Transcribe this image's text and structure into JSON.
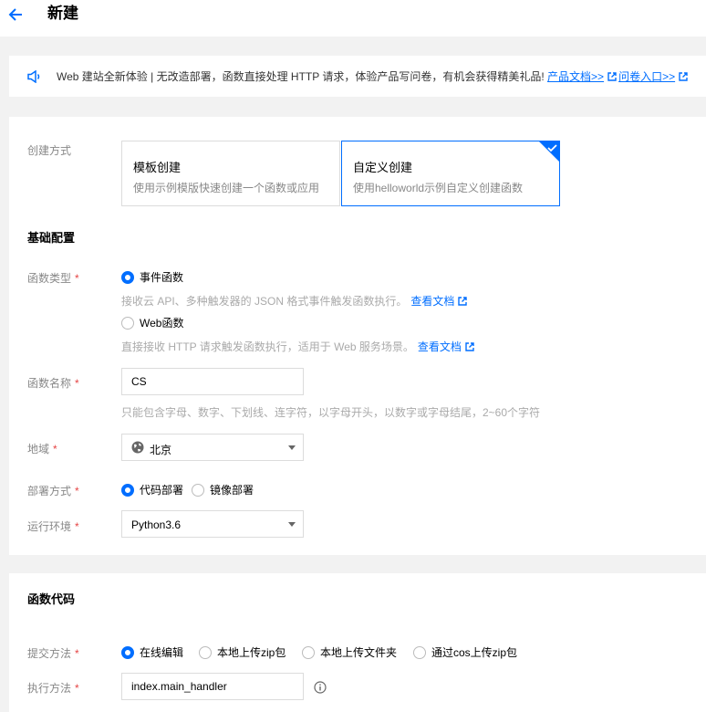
{
  "header": {
    "title": "新建"
  },
  "notice": {
    "text": "Web 建站全新体验 | 无改造部署，函数直接处理 HTTP 请求，体验产品写问卷，有机会获得精美礼品!",
    "link_docs": "产品文档>>",
    "link_survey": "问卷入口>>"
  },
  "create_method": {
    "label": "创建方式",
    "cards": [
      {
        "title": "模板创建",
        "desc": "使用示例模版快速创建一个函数或应用"
      },
      {
        "title": "自定义创建",
        "desc": "使用helloworld示例自定义创建函数"
      }
    ],
    "selected_index": 1
  },
  "basic": {
    "section_title": "基础配置",
    "function_type": {
      "label": "函数类型",
      "options": [
        {
          "label": "事件函数",
          "hint": "接收云 API、多种触发器的 JSON 格式事件触发函数执行。",
          "hint_link": "查看文档"
        },
        {
          "label": "Web函数",
          "hint": "直接接收 HTTP 请求触发函数执行，适用于 Web 服务场景。",
          "hint_link": "查看文档"
        }
      ],
      "selected": "事件函数"
    },
    "function_name": {
      "label": "函数名称",
      "value": "CS",
      "hint": "只能包含字母、数字、下划线、连字符，以字母开头，以数字或字母结尾，2~60个字符"
    },
    "region": {
      "label": "地域",
      "value": "北京"
    },
    "deploy": {
      "label": "部署方式",
      "options": [
        "代码部署",
        "镜像部署"
      ],
      "selected": "代码部署"
    },
    "runtime": {
      "label": "运行环境",
      "value": "Python3.6"
    }
  },
  "code": {
    "section_title": "函数代码",
    "submit": {
      "label": "提交方法",
      "options": [
        "在线编辑",
        "本地上传zip包",
        "本地上传文件夹",
        "通过cos上传zip包"
      ],
      "selected": "在线编辑"
    },
    "handler": {
      "label": "执行方法",
      "value": "index.main_handler"
    }
  },
  "required_mark": "*",
  "colors": {
    "accent": "#006eff",
    "required": "#e54545",
    "background": "#f2f2f2"
  }
}
